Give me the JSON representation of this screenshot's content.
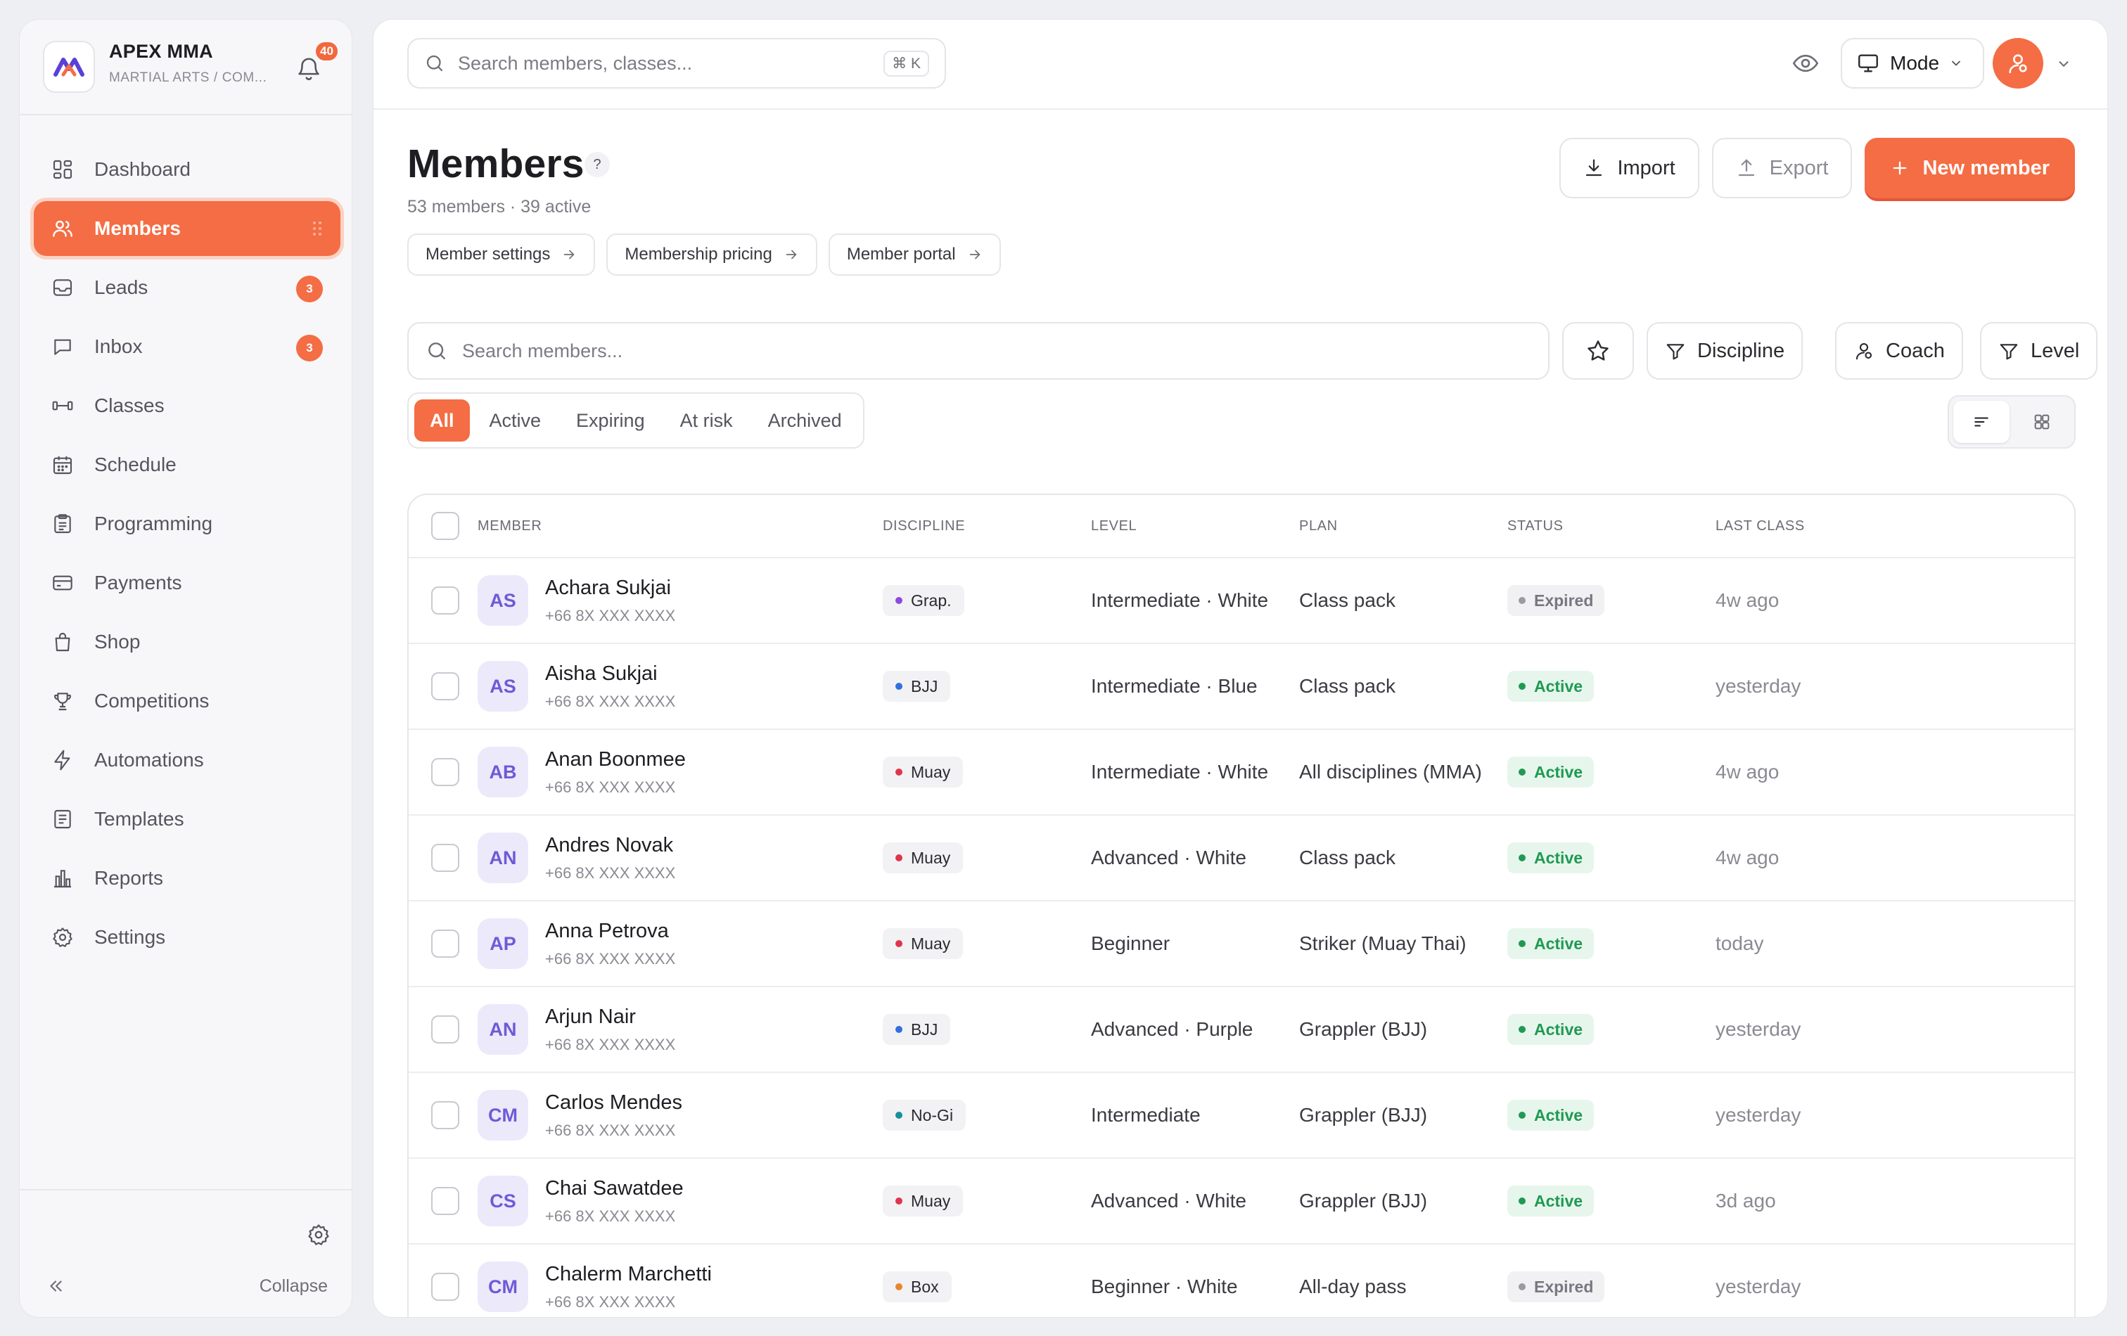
{
  "brand": {
    "name": "APEX MMA",
    "subtitle": "MARTIAL ARTS / COM...",
    "notifications": "40"
  },
  "sidebar": {
    "items": [
      {
        "label": "Dashboard",
        "icon": "dashboard-icon"
      },
      {
        "label": "Members",
        "icon": "users-icon",
        "active": true
      },
      {
        "label": "Leads",
        "icon": "inbox-tray-icon",
        "badge": "3"
      },
      {
        "label": "Inbox",
        "icon": "chat-bubble-icon",
        "badge": "3"
      },
      {
        "label": "Classes",
        "icon": "dumbbell-icon"
      },
      {
        "label": "Schedule",
        "icon": "calendar-icon"
      },
      {
        "label": "Programming",
        "icon": "clipboard-icon"
      },
      {
        "label": "Payments",
        "icon": "credit-card-icon"
      },
      {
        "label": "Shop",
        "icon": "shopping-bag-icon"
      },
      {
        "label": "Competitions",
        "icon": "trophy-icon"
      },
      {
        "label": "Automations",
        "icon": "lightning-icon"
      },
      {
        "label": "Templates",
        "icon": "document-icon"
      },
      {
        "label": "Reports",
        "icon": "bar-chart-icon"
      },
      {
        "label": "Settings",
        "icon": "gear-icon"
      }
    ],
    "collapse_label": "Collapse"
  },
  "topbar": {
    "search_placeholder": "Search members, classes...",
    "shortcut": "⌘ K",
    "mode_label": "Mode"
  },
  "page": {
    "title": "Members",
    "help": "?",
    "subtitle": "53 members · 39 active",
    "quick_links": [
      "Member settings",
      "Membership pricing",
      "Member portal"
    ],
    "actions": {
      "import": "Import",
      "export": "Export",
      "new_member": "New member"
    }
  },
  "filters": {
    "search_placeholder": "Search members...",
    "discipline": "Discipline",
    "coach": "Coach",
    "level": "Level",
    "tabs": [
      "All",
      "Active",
      "Expiring",
      "At risk",
      "Archived"
    ],
    "active_tab": "All"
  },
  "table": {
    "columns": [
      "MEMBER",
      "DISCIPLINE",
      "LEVEL",
      "PLAN",
      "STATUS",
      "LAST CLASS"
    ],
    "rows": [
      {
        "initials": "AS",
        "name": "Achara Sukjai",
        "phone": "+66 8X XXX XXXX",
        "discipline": "Grap.",
        "disc_color": "#8b4be0",
        "level": "Intermediate · White",
        "plan": "Class pack",
        "status": "Expired",
        "last": "4w ago"
      },
      {
        "initials": "AS",
        "name": "Aisha Sukjai",
        "phone": "+66 8X XXX XXXX",
        "discipline": "BJJ",
        "disc_color": "#2f6fe0",
        "level": "Intermediate · Blue",
        "plan": "Class pack",
        "status": "Active",
        "last": "yesterday"
      },
      {
        "initials": "AB",
        "name": "Anan Boonmee",
        "phone": "+66 8X XXX XXXX",
        "discipline": "Muay",
        "disc_color": "#e0344a",
        "level": "Intermediate · White",
        "plan": "All disciplines (MMA)",
        "status": "Active",
        "last": "4w ago"
      },
      {
        "initials": "AN",
        "name": "Andres Novak",
        "phone": "+66 8X XXX XXXX",
        "discipline": "Muay",
        "disc_color": "#e0344a",
        "level": "Advanced · White",
        "plan": "Class pack",
        "status": "Active",
        "last": "4w ago"
      },
      {
        "initials": "AP",
        "name": "Anna Petrova",
        "phone": "+66 8X XXX XXXX",
        "discipline": "Muay",
        "disc_color": "#e0344a",
        "level": "Beginner",
        "plan": "Striker (Muay Thai)",
        "status": "Active",
        "last": "today"
      },
      {
        "initials": "AN",
        "name": "Arjun Nair",
        "phone": "+66 8X XXX XXXX",
        "discipline": "BJJ",
        "disc_color": "#2f6fe0",
        "level": "Advanced · Purple",
        "plan": "Grappler (BJJ)",
        "status": "Active",
        "last": "yesterday"
      },
      {
        "initials": "CM",
        "name": "Carlos Mendes",
        "phone": "+66 8X XXX XXXX",
        "discipline": "No-Gi",
        "disc_color": "#178f9e",
        "level": "Intermediate",
        "plan": "Grappler (BJJ)",
        "status": "Active",
        "last": "yesterday"
      },
      {
        "initials": "CS",
        "name": "Chai Sawatdee",
        "phone": "+66 8X XXX XXXX",
        "discipline": "Muay",
        "disc_color": "#e0344a",
        "level": "Advanced · White",
        "plan": "Grappler (BJJ)",
        "status": "Active",
        "last": "3d ago"
      },
      {
        "initials": "CM",
        "name": "Chalerm Marchetti",
        "phone": "+66 8X XXX XXXX",
        "discipline": "Box",
        "disc_color": "#e8862c",
        "level": "Beginner · White",
        "plan": "All-day pass",
        "status": "Expired",
        "last": "yesterday"
      }
    ]
  },
  "colors": {
    "accent": "#f46d44",
    "active_status": "#1f9a52",
    "avatar_bg": "#ece9fb"
  }
}
